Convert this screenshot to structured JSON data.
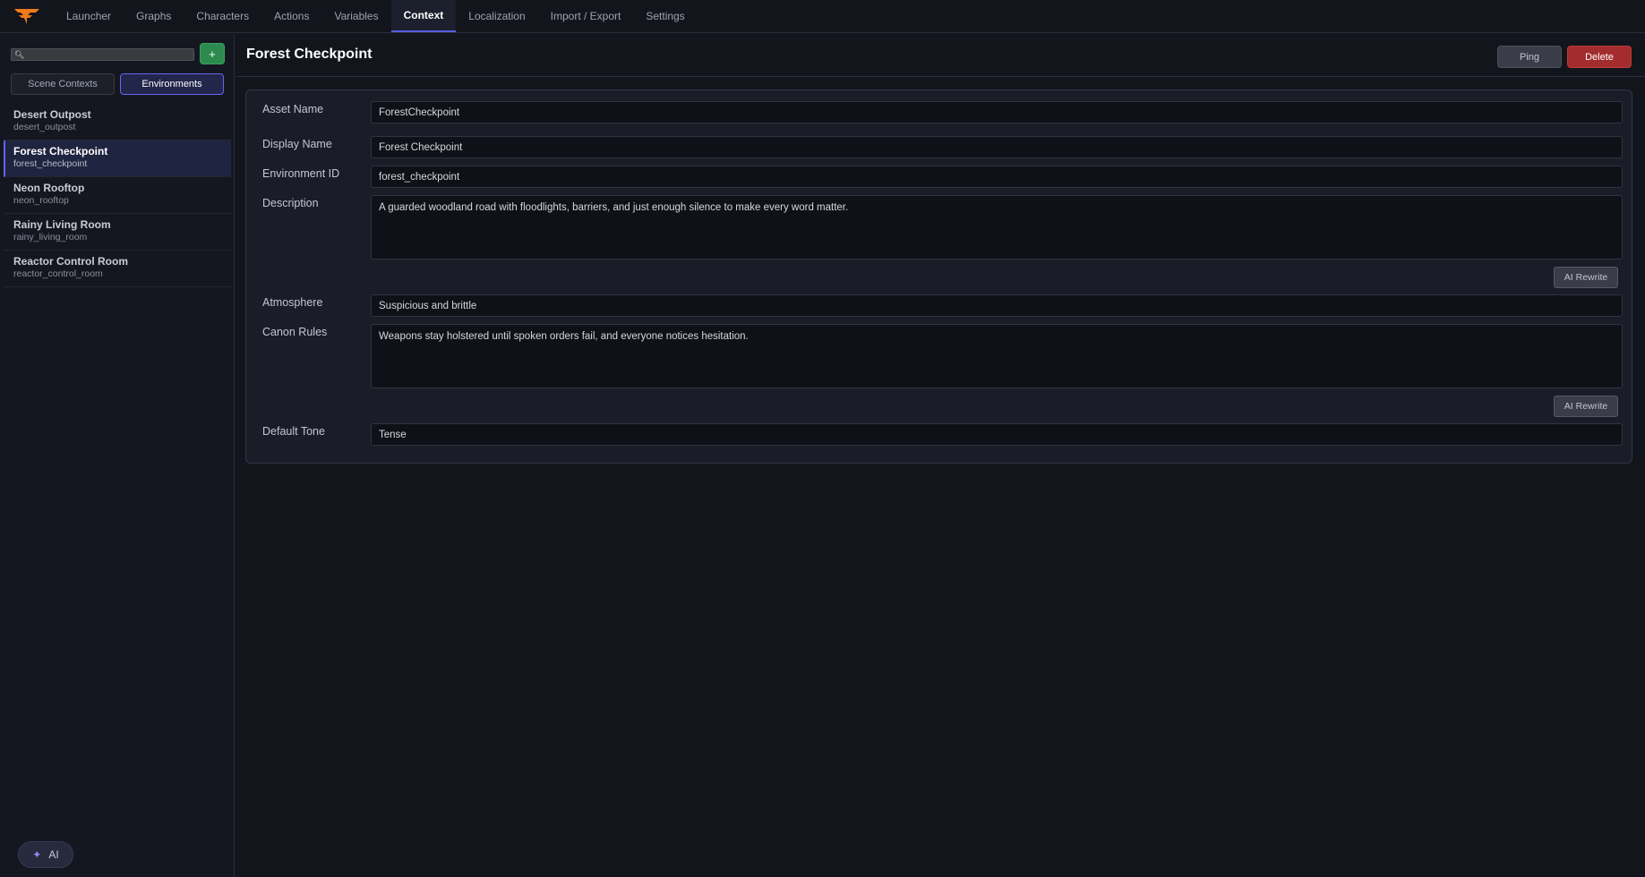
{
  "nav": {
    "tabs": [
      "Launcher",
      "Graphs",
      "Characters",
      "Actions",
      "Variables",
      "Context",
      "Localization",
      "Import / Export",
      "Settings"
    ],
    "active_tab": "Context"
  },
  "sidebar": {
    "search": {
      "value": "",
      "icon": "search-icon"
    },
    "add_label": "+",
    "toggles": [
      {
        "label": "Scene Contexts",
        "active": false
      },
      {
        "label": "Environments",
        "active": true
      }
    ],
    "items": [
      {
        "name": "Desert Outpost",
        "id": "desert_outpost",
        "active": false
      },
      {
        "name": "Forest Checkpoint",
        "id": "forest_checkpoint",
        "active": true
      },
      {
        "name": "Neon Rooftop",
        "id": "neon_rooftop",
        "active": false
      },
      {
        "name": "Rainy Living Room",
        "id": "rainy_living_room",
        "active": false
      },
      {
        "name": "Reactor Control Room",
        "id": "reactor_control_room",
        "active": false
      }
    ],
    "ai_button": {
      "icon": "sparkle-icon",
      "label": "AI"
    }
  },
  "main": {
    "title": "Forest Checkpoint",
    "ping_label": "Ping",
    "delete_label": "Delete",
    "form": {
      "asset_name": {
        "label": "Asset Name",
        "value": "ForestCheckpoint"
      },
      "display_name": {
        "label": "Display Name",
        "value": "Forest Checkpoint"
      },
      "environment_id": {
        "label": "Environment ID",
        "value": "forest_checkpoint"
      },
      "description": {
        "label": "Description",
        "value": "A guarded woodland road with floodlights, barriers, and just enough silence to make every word matter."
      },
      "description_rewrite": "AI Rewrite",
      "atmosphere": {
        "label": "Atmosphere",
        "value": "Suspicious and brittle"
      },
      "canon_rules": {
        "label": "Canon Rules",
        "value": "Weapons stay holstered until spoken orders fail, and everyone notices hesitation."
      },
      "canon_rewrite": "AI Rewrite",
      "default_tone": {
        "label": "Default Tone",
        "value": "Tense"
      }
    }
  },
  "colors": {
    "accent": "#6366f1",
    "add_green": "#2d8a4f",
    "delete_red": "#a32d2d",
    "logo_orange": "#f07a1a"
  }
}
